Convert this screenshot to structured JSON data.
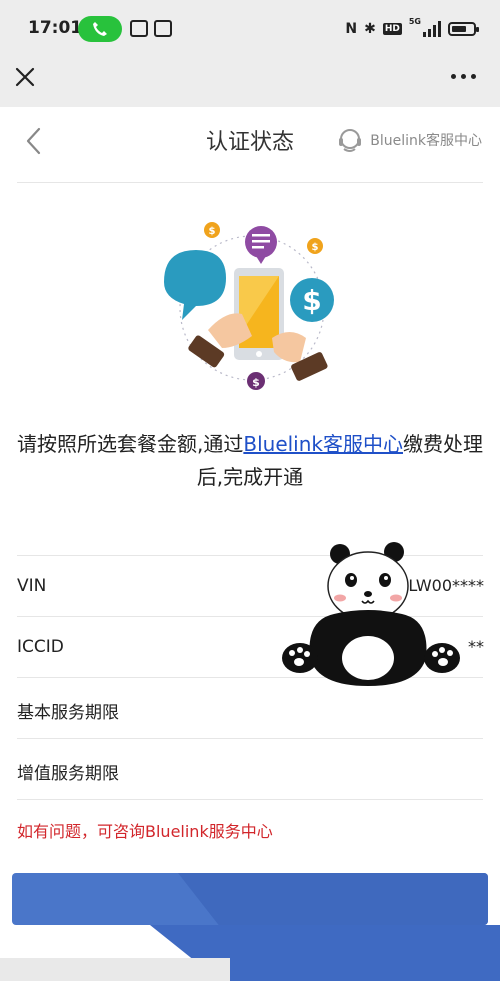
{
  "status_bar": {
    "time": "17:01",
    "network": "5G",
    "icons": [
      "call-icon",
      "mail-icon",
      "news-app-icon",
      "nfc-icon",
      "bluetooth-icon",
      "hd-icon",
      "signal-icon",
      "battery-icon"
    ]
  },
  "webview": {
    "close_icon": "close-icon",
    "more_icon": "more-icon"
  },
  "header": {
    "title": "认证状态",
    "service_label": "Bluelink客服中心"
  },
  "message": {
    "before": "请按照所选套餐金额,通过",
    "link": "Bluelink客服中心",
    "after": "缴费处理后,完成开通"
  },
  "info": {
    "rows": [
      {
        "label": "VIN",
        "value": "LW00****"
      },
      {
        "label": "ICCID",
        "value": "**"
      },
      {
        "label": "基本服务期限",
        "value": ""
      },
      {
        "label": "增值服务期限",
        "value": ""
      }
    ]
  },
  "help": {
    "text": "如有问题，可咨询Bluelink服务中心"
  },
  "colors": {
    "accent_blue": "#4a76c9",
    "link_blue": "#1f50c8",
    "help_red": "#d2262b",
    "call_green": "#28c23c"
  }
}
